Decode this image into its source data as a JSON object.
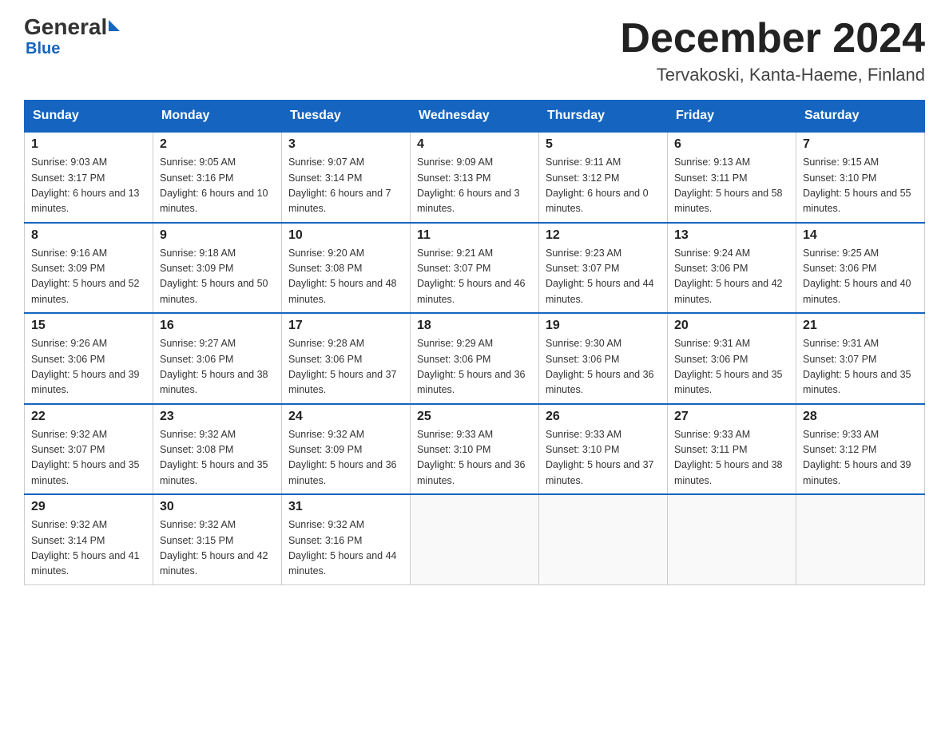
{
  "header": {
    "logo_general": "General",
    "logo_blue": "Blue",
    "month_title": "December 2024",
    "location": "Tervakoski, Kanta-Haeme, Finland"
  },
  "days_of_week": [
    "Sunday",
    "Monday",
    "Tuesday",
    "Wednesday",
    "Thursday",
    "Friday",
    "Saturday"
  ],
  "weeks": [
    [
      {
        "day": "1",
        "sunrise": "9:03 AM",
        "sunset": "3:17 PM",
        "daylight": "6 hours and 13 minutes."
      },
      {
        "day": "2",
        "sunrise": "9:05 AM",
        "sunset": "3:16 PM",
        "daylight": "6 hours and 10 minutes."
      },
      {
        "day": "3",
        "sunrise": "9:07 AM",
        "sunset": "3:14 PM",
        "daylight": "6 hours and 7 minutes."
      },
      {
        "day": "4",
        "sunrise": "9:09 AM",
        "sunset": "3:13 PM",
        "daylight": "6 hours and 3 minutes."
      },
      {
        "day": "5",
        "sunrise": "9:11 AM",
        "sunset": "3:12 PM",
        "daylight": "6 hours and 0 minutes."
      },
      {
        "day": "6",
        "sunrise": "9:13 AM",
        "sunset": "3:11 PM",
        "daylight": "5 hours and 58 minutes."
      },
      {
        "day": "7",
        "sunrise": "9:15 AM",
        "sunset": "3:10 PM",
        "daylight": "5 hours and 55 minutes."
      }
    ],
    [
      {
        "day": "8",
        "sunrise": "9:16 AM",
        "sunset": "3:09 PM",
        "daylight": "5 hours and 52 minutes."
      },
      {
        "day": "9",
        "sunrise": "9:18 AM",
        "sunset": "3:09 PM",
        "daylight": "5 hours and 50 minutes."
      },
      {
        "day": "10",
        "sunrise": "9:20 AM",
        "sunset": "3:08 PM",
        "daylight": "5 hours and 48 minutes."
      },
      {
        "day": "11",
        "sunrise": "9:21 AM",
        "sunset": "3:07 PM",
        "daylight": "5 hours and 46 minutes."
      },
      {
        "day": "12",
        "sunrise": "9:23 AM",
        "sunset": "3:07 PM",
        "daylight": "5 hours and 44 minutes."
      },
      {
        "day": "13",
        "sunrise": "9:24 AM",
        "sunset": "3:06 PM",
        "daylight": "5 hours and 42 minutes."
      },
      {
        "day": "14",
        "sunrise": "9:25 AM",
        "sunset": "3:06 PM",
        "daylight": "5 hours and 40 minutes."
      }
    ],
    [
      {
        "day": "15",
        "sunrise": "9:26 AM",
        "sunset": "3:06 PM",
        "daylight": "5 hours and 39 minutes."
      },
      {
        "day": "16",
        "sunrise": "9:27 AM",
        "sunset": "3:06 PM",
        "daylight": "5 hours and 38 minutes."
      },
      {
        "day": "17",
        "sunrise": "9:28 AM",
        "sunset": "3:06 PM",
        "daylight": "5 hours and 37 minutes."
      },
      {
        "day": "18",
        "sunrise": "9:29 AM",
        "sunset": "3:06 PM",
        "daylight": "5 hours and 36 minutes."
      },
      {
        "day": "19",
        "sunrise": "9:30 AM",
        "sunset": "3:06 PM",
        "daylight": "5 hours and 36 minutes."
      },
      {
        "day": "20",
        "sunrise": "9:31 AM",
        "sunset": "3:06 PM",
        "daylight": "5 hours and 35 minutes."
      },
      {
        "day": "21",
        "sunrise": "9:31 AM",
        "sunset": "3:07 PM",
        "daylight": "5 hours and 35 minutes."
      }
    ],
    [
      {
        "day": "22",
        "sunrise": "9:32 AM",
        "sunset": "3:07 PM",
        "daylight": "5 hours and 35 minutes."
      },
      {
        "day": "23",
        "sunrise": "9:32 AM",
        "sunset": "3:08 PM",
        "daylight": "5 hours and 35 minutes."
      },
      {
        "day": "24",
        "sunrise": "9:32 AM",
        "sunset": "3:09 PM",
        "daylight": "5 hours and 36 minutes."
      },
      {
        "day": "25",
        "sunrise": "9:33 AM",
        "sunset": "3:10 PM",
        "daylight": "5 hours and 36 minutes."
      },
      {
        "day": "26",
        "sunrise": "9:33 AM",
        "sunset": "3:10 PM",
        "daylight": "5 hours and 37 minutes."
      },
      {
        "day": "27",
        "sunrise": "9:33 AM",
        "sunset": "3:11 PM",
        "daylight": "5 hours and 38 minutes."
      },
      {
        "day": "28",
        "sunrise": "9:33 AM",
        "sunset": "3:12 PM",
        "daylight": "5 hours and 39 minutes."
      }
    ],
    [
      {
        "day": "29",
        "sunrise": "9:32 AM",
        "sunset": "3:14 PM",
        "daylight": "5 hours and 41 minutes."
      },
      {
        "day": "30",
        "sunrise": "9:32 AM",
        "sunset": "3:15 PM",
        "daylight": "5 hours and 42 minutes."
      },
      {
        "day": "31",
        "sunrise": "9:32 AM",
        "sunset": "3:16 PM",
        "daylight": "5 hours and 44 minutes."
      },
      null,
      null,
      null,
      null
    ]
  ]
}
